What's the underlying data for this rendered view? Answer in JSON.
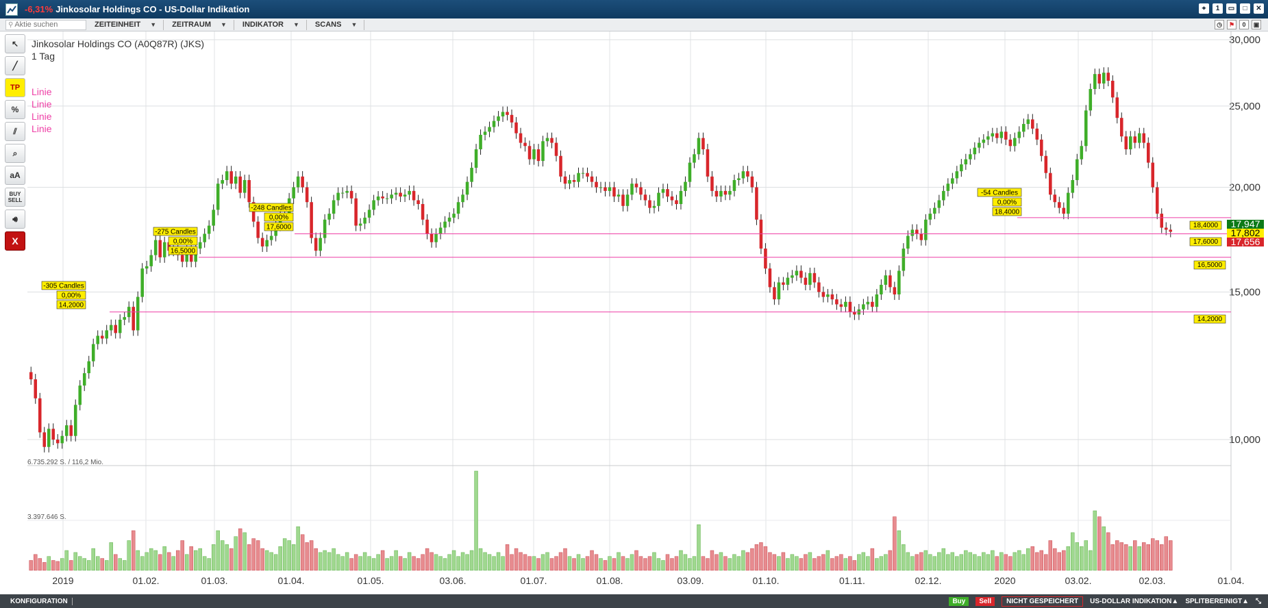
{
  "window": {
    "change": "-6,31%",
    "title": "Jinkosolar Holdings CO - US-Dollar Indikation"
  },
  "toolbar": {
    "search_placeholder": "Aktie suchen",
    "menus": [
      "ZEITEINHEIT",
      "ZEITRAUM",
      "INDIKATOR",
      "SCANS"
    ]
  },
  "tools": {
    "tp": "TP",
    "percent": "%",
    "text": "aA",
    "buy_sell": "BUY SELL",
    "close": "X"
  },
  "chart_header": {
    "instrument": "Jinkosolar Holdings CO (A0Q87R) (JKS)",
    "timeframe": "1 Tag",
    "line_labels": [
      "Linie",
      "Linie",
      "Linie",
      "Linie"
    ]
  },
  "volume_labels": {
    "max": "6.735.292 S. / 116,2 Mio.",
    "mid": "3.397.646 S."
  },
  "status": {
    "config": "KONFIGURATION",
    "buy": "Buy",
    "sell": "Sell",
    "not_saved": "NICHT GESPEICHERT",
    "currency": "US-DOLLAR INDIKATION▲",
    "split": "SPLITBEREINIGT▲"
  },
  "chart_data": {
    "type": "candlestick",
    "y_scale": "log",
    "y_ticks": [
      10000,
      15000,
      20000,
      25000,
      30000
    ],
    "y_tick_labels": [
      "10,000",
      "15,000",
      "20,000",
      "25,000",
      "30,000"
    ],
    "x_tick_labels": [
      "2019",
      "01.02.",
      "01.03.",
      "01.04.",
      "01.05.",
      "03.06.",
      "01.07.",
      "01.08.",
      "03.09.",
      "01.10.",
      "01.11.",
      "02.12.",
      "2020",
      "03.02.",
      "02.03.",
      "01.04."
    ],
    "horizontal_lines": [
      {
        "value": 18.4,
        "label": "18,4000"
      },
      {
        "value": 17.6,
        "label": "17,6000"
      },
      {
        "value": 16.5,
        "label": "16,5000"
      },
      {
        "value": 14.2,
        "label": "14,2000"
      }
    ],
    "line_annotations": [
      {
        "candles": "-305 Candles",
        "pct": "0,00%",
        "price": "14,2000"
      },
      {
        "candles": "-275 Candles",
        "pct": "0,00%",
        "price": "16,5000"
      },
      {
        "candles": "-248 Candles",
        "pct": "0,00%",
        "price": "17,6000"
      },
      {
        "candles": "-54 Candles",
        "pct": "0,00%",
        "price": "18,4000"
      }
    ],
    "price_badges": [
      {
        "label": "17,947",
        "color": "#0c7a18"
      },
      {
        "label": "17,802",
        "color": "#ffee00"
      },
      {
        "label": "17,656",
        "color": "#d8262b"
      }
    ],
    "closes": [
      11.8,
      11.2,
      10.2,
      9.8,
      10.3,
      10.0,
      9.9,
      10.1,
      10.4,
      10.1,
      11.0,
      11.6,
      12.0,
      12.4,
      13.0,
      13.3,
      13.2,
      13.5,
      13.7,
      13.4,
      13.9,
      14.0,
      14.4,
      13.5,
      14.8,
      16.0,
      16.1,
      16.6,
      17.3,
      16.5,
      17.2,
      16.8,
      17.0,
      16.6,
      16.3,
      16.9,
      16.3,
      16.9,
      17.2,
      17.6,
      18.0,
      18.8,
      20.2,
      20.4,
      20.9,
      20.2,
      20.6,
      19.7,
      20.4,
      19.2,
      18.2,
      17.4,
      17.0,
      17.3,
      17.5,
      18.0,
      18.5,
      18.6,
      19.4,
      20.0,
      20.6,
      20.0,
      19.2,
      17.4,
      16.8,
      17.4,
      18.3,
      18.6,
      19.3,
      19.7,
      19.7,
      19.8,
      19.4,
      18.0,
      18.1,
      18.4,
      18.8,
      19.3,
      19.5,
      19.4,
      19.4,
      19.6,
      19.7,
      19.5,
      19.6,
      19.8,
      19.3,
      19.1,
      18.3,
      17.6,
      17.2,
      17.6,
      17.9,
      18.2,
      18.4,
      18.6,
      19.2,
      19.6,
      20.3,
      21.1,
      22.2,
      23.1,
      23.3,
      23.6,
      24.0,
      24.3,
      24.6,
      24.4,
      23.9,
      23.2,
      22.6,
      22.4,
      21.6,
      22.2,
      21.5,
      22.7,
      22.9,
      22.6,
      21.8,
      20.6,
      20.2,
      20.4,
      20.3,
      20.8,
      20.8,
      20.6,
      20.3,
      20.0,
      20.0,
      19.8,
      20.0,
      19.5,
      19.6,
      19.0,
      19.6,
      20.2,
      20.0,
      19.6,
      19.3,
      18.9,
      19.0,
      19.7,
      19.9,
      19.5,
      19.3,
      19.1,
      19.8,
      20.3,
      21.4,
      21.9,
      22.9,
      22.2,
      20.6,
      19.8,
      19.5,
      19.8,
      19.6,
      19.8,
      20.4,
      20.5,
      20.9,
      20.6,
      20.0,
      18.3,
      16.9,
      16.0,
      15.2,
      14.7,
      15.4,
      15.3,
      15.6,
      15.7,
      15.9,
      15.6,
      15.3,
      15.8,
      15.4,
      15.0,
      14.8,
      14.9,
      14.7,
      14.5,
      14.4,
      14.6,
      14.2,
      14.1,
      14.3,
      14.5,
      14.6,
      14.4,
      14.9,
      15.3,
      15.7,
      15.2,
      14.9,
      15.9,
      16.9,
      17.5,
      17.8,
      17.6,
      17.3,
      18.3,
      18.6,
      18.9,
      19.3,
      19.8,
      20.2,
      20.5,
      20.9,
      21.3,
      21.6,
      21.9,
      22.3,
      22.6,
      22.8,
      23.0,
      23.2,
      22.9,
      23.3,
      22.8,
      22.4,
      22.9,
      23.3,
      23.8,
      24.1,
      23.5,
      22.8,
      21.8,
      20.8,
      19.6,
      19.2,
      18.9,
      18.6,
      19.7,
      20.4,
      21.6,
      22.4,
      24.7,
      26.2,
      27.3,
      26.6,
      27.4,
      26.8,
      25.6,
      24.2,
      23.0,
      22.2,
      23.0,
      22.6,
      23.2,
      22.6,
      21.4,
      20.0,
      18.6,
      17.9,
      17.8,
      17.7
    ],
    "volumes_rel": [
      0.1,
      0.16,
      0.12,
      0.08,
      0.14,
      0.1,
      0.09,
      0.12,
      0.2,
      0.1,
      0.18,
      0.14,
      0.12,
      0.1,
      0.22,
      0.14,
      0.12,
      0.1,
      0.28,
      0.16,
      0.12,
      0.1,
      0.3,
      0.4,
      0.2,
      0.14,
      0.18,
      0.22,
      0.2,
      0.16,
      0.24,
      0.18,
      0.14,
      0.2,
      0.3,
      0.16,
      0.24,
      0.2,
      0.22,
      0.14,
      0.12,
      0.26,
      0.4,
      0.3,
      0.26,
      0.22,
      0.34,
      0.42,
      0.38,
      0.26,
      0.32,
      0.3,
      0.22,
      0.2,
      0.18,
      0.16,
      0.24,
      0.32,
      0.3,
      0.26,
      0.44,
      0.36,
      0.28,
      0.3,
      0.22,
      0.18,
      0.2,
      0.18,
      0.22,
      0.16,
      0.14,
      0.18,
      0.12,
      0.16,
      0.14,
      0.18,
      0.14,
      0.12,
      0.16,
      0.2,
      0.12,
      0.14,
      0.2,
      0.14,
      0.12,
      0.18,
      0.14,
      0.12,
      0.16,
      0.22,
      0.18,
      0.16,
      0.14,
      0.12,
      0.16,
      0.2,
      0.14,
      0.18,
      0.16,
      0.2,
      1.0,
      0.22,
      0.18,
      0.16,
      0.14,
      0.18,
      0.14,
      0.26,
      0.16,
      0.22,
      0.18,
      0.16,
      0.14,
      0.14,
      0.12,
      0.16,
      0.18,
      0.12,
      0.14,
      0.18,
      0.22,
      0.14,
      0.12,
      0.16,
      0.12,
      0.14,
      0.2,
      0.16,
      0.12,
      0.1,
      0.14,
      0.12,
      0.18,
      0.14,
      0.12,
      0.16,
      0.2,
      0.14,
      0.12,
      0.14,
      0.18,
      0.12,
      0.1,
      0.16,
      0.12,
      0.14,
      0.2,
      0.16,
      0.12,
      0.14,
      0.46,
      0.14,
      0.12,
      0.2,
      0.16,
      0.18,
      0.14,
      0.12,
      0.16,
      0.14,
      0.2,
      0.18,
      0.22,
      0.26,
      0.28,
      0.24,
      0.18,
      0.16,
      0.14,
      0.18,
      0.12,
      0.16,
      0.14,
      0.12,
      0.16,
      0.18,
      0.12,
      0.14,
      0.16,
      0.2,
      0.12,
      0.14,
      0.16,
      0.12,
      0.14,
      0.1,
      0.16,
      0.18,
      0.14,
      0.22,
      0.12,
      0.14,
      0.16,
      0.2,
      0.54,
      0.4,
      0.26,
      0.18,
      0.14,
      0.16,
      0.18,
      0.2,
      0.16,
      0.14,
      0.18,
      0.22,
      0.16,
      0.18,
      0.14,
      0.16,
      0.2,
      0.18,
      0.16,
      0.14,
      0.18,
      0.16,
      0.2,
      0.14,
      0.18,
      0.16,
      0.14,
      0.18,
      0.2,
      0.16,
      0.22,
      0.24,
      0.18,
      0.2,
      0.16,
      0.3,
      0.22,
      0.18,
      0.2,
      0.24,
      0.38,
      0.28,
      0.24,
      0.3,
      0.2,
      0.6,
      0.54,
      0.44,
      0.38,
      0.26,
      0.3,
      0.28,
      0.26,
      0.24,
      0.3,
      0.24,
      0.28,
      0.26,
      0.32,
      0.3,
      0.26,
      0.34,
      0.3
    ],
    "last_badge_labels": [
      "18,4000",
      "17,6000",
      "16,5000",
      "14,2000"
    ]
  }
}
